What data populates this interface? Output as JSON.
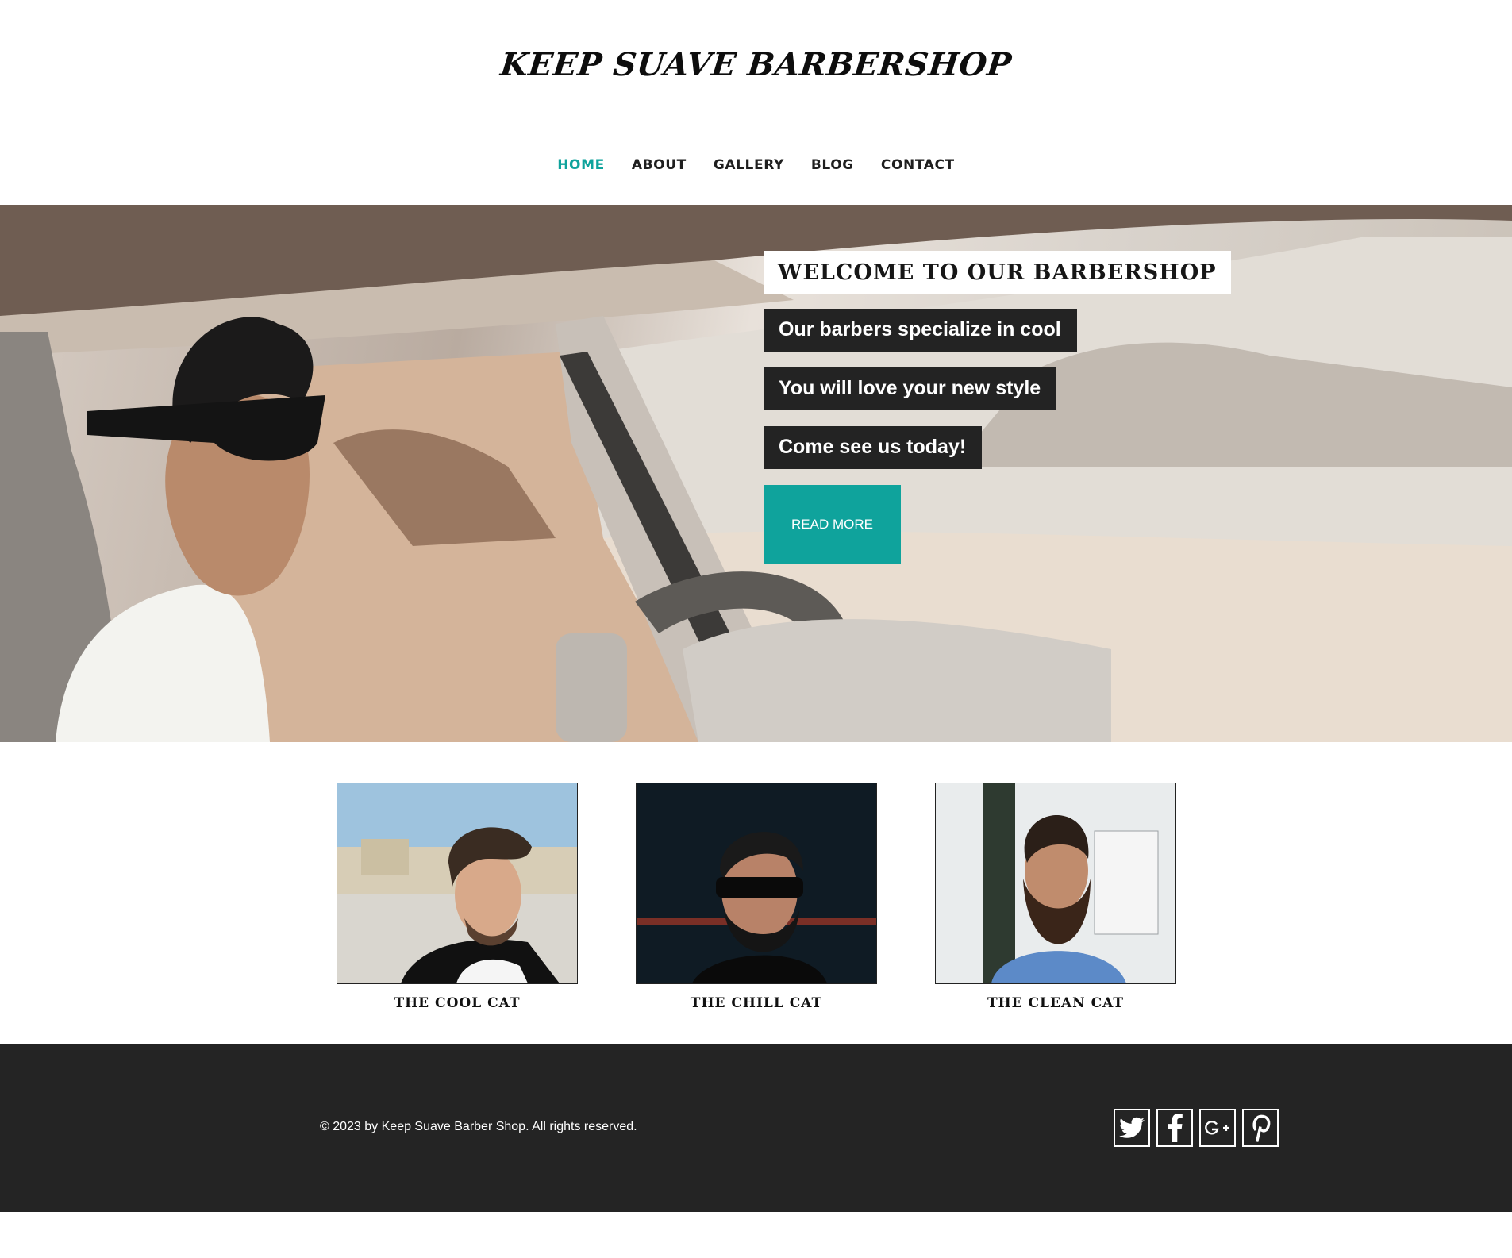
{
  "site": {
    "title": "KEEP SUAVE BARBERSHOP"
  },
  "nav": {
    "items": [
      {
        "label": "HOME",
        "active": true
      },
      {
        "label": "ABOUT",
        "active": false
      },
      {
        "label": "GALLERY",
        "active": false
      },
      {
        "label": "BLOG",
        "active": false
      },
      {
        "label": "CONTACT",
        "active": false
      }
    ]
  },
  "hero": {
    "heading": "WELCOME TO OUR BARBERSHOP",
    "lines": [
      "Our barbers specialize in cool",
      "You will love your new style",
      "Come see us today!"
    ],
    "button_label": "READ MORE"
  },
  "gallery": {
    "cards": [
      {
        "caption": "THE COOL CAT"
      },
      {
        "caption": "THE CHILL CAT"
      },
      {
        "caption": "THE CLEAN CAT"
      }
    ]
  },
  "footer": {
    "copyright": "© 2023 by Keep Suave Barber Shop. All rights reserved.",
    "social": [
      "twitter-icon",
      "facebook-icon",
      "google-plus-icon",
      "pinterest-icon"
    ]
  },
  "colors": {
    "accent": "#0fa39c",
    "dark": "#232323",
    "footer_bg": "#242424"
  }
}
